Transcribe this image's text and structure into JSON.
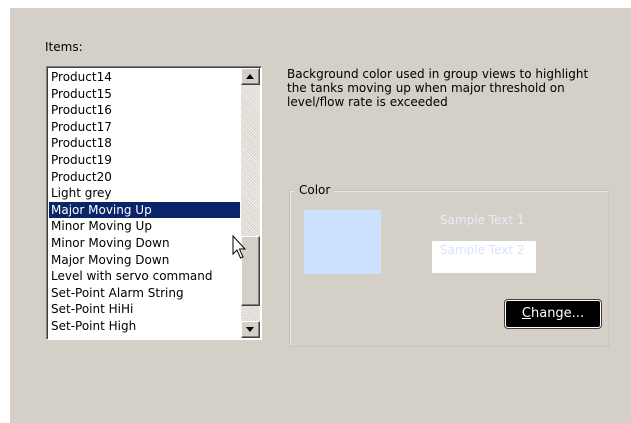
{
  "items": {
    "label": "Items:",
    "list": [
      "Product14",
      "Product15",
      "Product16",
      "Product17",
      "Product18",
      "Product19",
      "Product20",
      "Light grey",
      "Major Moving Up",
      "Minor Moving Up",
      "Minor Moving Down",
      "Major Moving Down",
      "Level with servo command",
      "Set-Point Alarm String",
      "Set-Point HiHi",
      "Set-Point High"
    ],
    "selected_index": 8
  },
  "description": "Background color used in group views to highlight the tanks moving up when major threshold on level/flow rate is exceeded",
  "color_group": {
    "label": "Color",
    "swatch_color": "#cce0ff",
    "sample_text_1": "Sample Text 1",
    "sample_text_2": "Sample Text 2",
    "change_button_first": "C",
    "change_button_rest": "hange..."
  },
  "icons": {
    "scroll_up": "scroll-up-arrow-icon",
    "scroll_down": "scroll-down-arrow-icon",
    "cursor": "mouse-pointer-icon"
  }
}
